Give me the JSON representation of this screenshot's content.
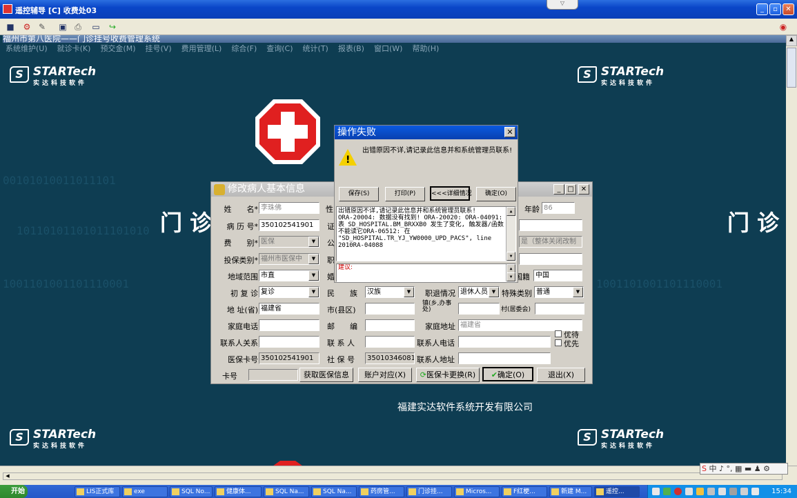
{
  "window": {
    "title": "遥控辅导 [C] 收费处03"
  },
  "inner": {
    "title": "福州市第八医院——门诊挂号收费管理系统",
    "menu": [
      "系统维护(U)",
      "就诊卡(K)",
      "预交金(M)",
      "挂号(V)",
      "费用管理(L)",
      "综合(F)",
      "查询(C)",
      "统计(T)",
      "报表(B)",
      "窗口(W)",
      "帮助(H)"
    ]
  },
  "desktop": {
    "logo_brand": "STARTech",
    "logo_s": "S",
    "logo_cn": "实达科技软件",
    "big_left": "门 诊",
    "big_right": "门 诊",
    "company": "福建实达软件系统开发有限公司",
    "watermark1": "00101010011011101",
    "watermark2": "10110101101011101010",
    "watermark3": "1001101001101110001"
  },
  "edit_dialog": {
    "title": "修改病人基本信息",
    "labels": {
      "name": "姓　　名*",
      "record": "病 历 号*",
      "feetype": "费　　别*",
      "insurance": "投保类别*",
      "region": "地域范围",
      "firstrevisit": "初 复 诊",
      "address_prov": "地 址(省)",
      "homephone": "家庭电话",
      "contactrel": "联系人关系",
      "medcard": "医保卡号",
      "cardno": "卡号",
      "sex": "性",
      "id": "证",
      "public": "公",
      "job": "职",
      "marriage": "婚",
      "nation": "民　　族",
      "retire": "职退情况",
      "special": "特殊类别",
      "city": "市(县区)",
      "postcode": "邮　　编",
      "homeaddr": "家庭地址",
      "contact": "联 系 人",
      "contactphone": "联系人电话",
      "socialno": "社 保 号",
      "contactaddr": "联系人地址",
      "age": "年龄",
      "nationality": "国籍",
      "town": "镇(乡,办事处)",
      "village": "村(居委会)",
      "priority": "优待",
      "preference": "优先"
    },
    "values": {
      "name": "李珠佛",
      "record": "350102541901",
      "feetype": "医保",
      "insurance": "福州市医保中",
      "region": "市直",
      "firstrevisit": "复诊",
      "address_prov": "福建省",
      "homeaddr": "福建省",
      "medcard": "350102541901",
      "nation": "汉族",
      "retire": "退休人员",
      "special": "普通",
      "socialno": "350103460811",
      "age": "86",
      "nationality": "中国",
      "public_note": "是（整体关闭改制"
    },
    "buttons": {
      "get_insurance": "获取医保信息",
      "account": "账户对应(X)",
      "card_replace": "医保卡更换(R)",
      "ok": "确定(O)",
      "exit": "退出(X)"
    }
  },
  "error_dialog": {
    "title": "操作失败",
    "message": "出错原因不详,请记录此信息并和系统管理员联系!",
    "buttons": {
      "save": "保存(S)",
      "print": "打印(P)",
      "details": "<<<详细情况",
      "ok": "确定(O)"
    },
    "detail": "出错原因不详,请记录此信息并和系统管理员联系!\nORA-20004: 数据没有找到! ORA-20020: ORA-04091: 表 SD_HOSPITAL.BM_BRXXB0 发生了变化, 触发器/函数不能读它ORA-06512: 在 \"SD_HOSPITAL.TR_YJ_YW0000_UPD_PACS\", line 2010RA-04088",
    "suggest_label": "建议:"
  },
  "ime": {
    "text": "中 ♪ °, ▦ ▬ ♟ ⚙"
  },
  "taskbar": {
    "start": "开始",
    "items": [
      "LIS正式库",
      "exe",
      "SQL No...",
      "健康体...",
      "SQL Na...",
      "SQL Na...",
      "药房管...",
      "门诊挂...",
      "Micros...",
      "F红梗...",
      "新建 M...",
      "遥控..."
    ],
    "clock": "15:34"
  },
  "colors": {
    "desktop": "#0e3d52",
    "titlebar": "#0a46c8",
    "dialog": "#d4d0c8"
  }
}
